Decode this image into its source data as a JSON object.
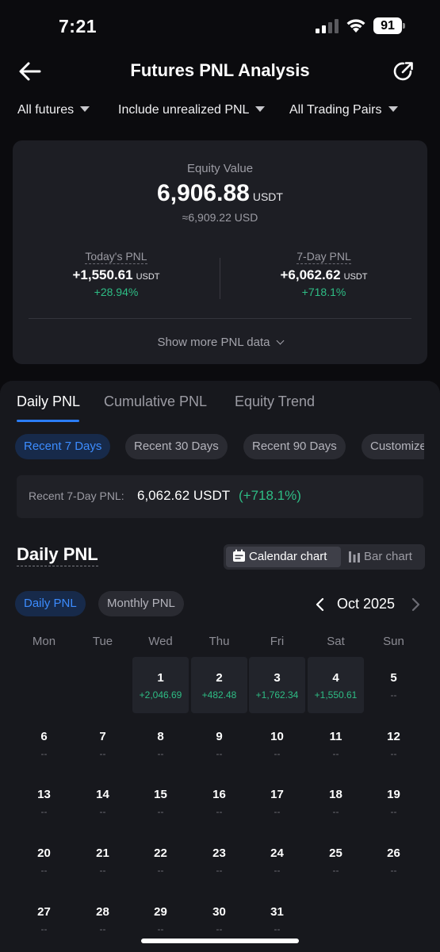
{
  "status_bar": {
    "time": "7:21",
    "battery": "91"
  },
  "header": {
    "title": "Futures PNL Analysis"
  },
  "filters": [
    {
      "label": "All futures"
    },
    {
      "label": "Include unrealized PNL"
    },
    {
      "label": "All Trading Pairs"
    }
  ],
  "equity": {
    "label": "Equity Value",
    "value": "6,906.88",
    "unit": "USDT",
    "usd": "≈6,909.22 USD"
  },
  "todays_pnl": {
    "label": "Today's PNL",
    "value": "+1,550.61",
    "unit": "USDT",
    "pct": "+28.94%"
  },
  "seven_day_pnl": {
    "label": "7-Day PNL",
    "value": "+6,062.62",
    "unit": "USDT",
    "pct": "+718.1%"
  },
  "show_more": "Show more PNL data",
  "tabs": [
    {
      "label": "Daily PNL",
      "active": true
    },
    {
      "label": "Cumulative PNL",
      "active": false
    },
    {
      "label": "Equity Trend",
      "active": false
    }
  ],
  "ranges": [
    {
      "label": "Recent 7 Days",
      "active": true
    },
    {
      "label": "Recent 30 Days",
      "active": false
    },
    {
      "label": "Recent 90 Days",
      "active": false
    },
    {
      "label": "Customize",
      "active": false
    }
  ],
  "summary": {
    "label": "Recent 7-Day PNL:",
    "value": "6,062.62 USDT",
    "pct": "(+718.1%)"
  },
  "daily_section": {
    "title": "Daily PNL",
    "calendar_btn": "Calendar chart",
    "bar_btn": "Bar chart",
    "period_tabs": [
      {
        "label": "Daily PNL",
        "active": true
      },
      {
        "label": "Monthly PNL",
        "active": false
      }
    ],
    "month": "Oct 2025"
  },
  "colors": {
    "accent": "#2b7df7",
    "positive": "#2ebd85",
    "card": "#1d1e24"
  },
  "calendar": {
    "weekdays": [
      "Mon",
      "Tue",
      "Wed",
      "Thu",
      "Fri",
      "Sat",
      "Sun"
    ],
    "days": [
      {
        "day": "1",
        "pnl": "+2,046.69"
      },
      {
        "day": "2",
        "pnl": "+482.48"
      },
      {
        "day": "3",
        "pnl": "+1,762.34"
      },
      {
        "day": "4",
        "pnl": "+1,550.61"
      },
      {
        "day": "5",
        "pnl": "--"
      },
      {
        "day": "6",
        "pnl": "--"
      },
      {
        "day": "7",
        "pnl": "--"
      },
      {
        "day": "8",
        "pnl": "--"
      },
      {
        "day": "9",
        "pnl": "--"
      },
      {
        "day": "10",
        "pnl": "--"
      },
      {
        "day": "11",
        "pnl": "--"
      },
      {
        "day": "12",
        "pnl": "--"
      },
      {
        "day": "13",
        "pnl": "--"
      },
      {
        "day": "14",
        "pnl": "--"
      },
      {
        "day": "15",
        "pnl": "--"
      },
      {
        "day": "16",
        "pnl": "--"
      },
      {
        "day": "17",
        "pnl": "--"
      },
      {
        "day": "18",
        "pnl": "--"
      },
      {
        "day": "19",
        "pnl": "--"
      },
      {
        "day": "20",
        "pnl": "--"
      },
      {
        "day": "21",
        "pnl": "--"
      },
      {
        "day": "22",
        "pnl": "--"
      },
      {
        "day": "23",
        "pnl": "--"
      },
      {
        "day": "24",
        "pnl": "--"
      },
      {
        "day": "25",
        "pnl": "--"
      },
      {
        "day": "26",
        "pnl": "--"
      },
      {
        "day": "27",
        "pnl": "--"
      },
      {
        "day": "28",
        "pnl": "--"
      },
      {
        "day": "29",
        "pnl": "--"
      },
      {
        "day": "30",
        "pnl": "--"
      },
      {
        "day": "31",
        "pnl": "--"
      }
    ]
  }
}
